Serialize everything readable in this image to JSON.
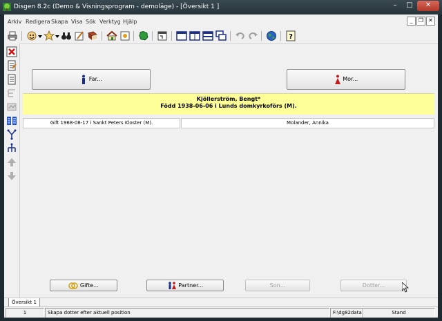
{
  "window": {
    "title": "Disgen 8.2c (Demo & Visningsprogram - demoläge) - [Översikt 1 ]",
    "controls": {
      "minimize": "–",
      "maximize": "□",
      "close": "✕"
    }
  },
  "menu": [
    "Arkiv",
    "Redigera",
    "Skapa",
    "Visa",
    "Sök",
    "Verktyg",
    "Hjälp"
  ],
  "mdi_controls": {
    "minimize": "_",
    "restore": "❐",
    "close": "✕"
  },
  "toolbar_icons": [
    "print-icon",
    "person-icon",
    "dropdown-icon",
    "person-search-icon",
    "dropdown-icon",
    "binoculars-icon",
    "notes-icon",
    "book-icon",
    "home-icon",
    "map-icon",
    "calendar-icon",
    "single-pane-icon",
    "split-pane-icon",
    "dual-pane-icon",
    "cascade-windows-icon",
    "undo-icon",
    "redo-icon",
    "globe-icon",
    "help-icon"
  ],
  "left_toolbar_icons": [
    "delete-icon",
    "edit-icon",
    "document-icon",
    "tree-icon",
    "chart-icon",
    "family-icon",
    "descendants-icon",
    "ancestors-icon",
    "arrow-up-icon",
    "arrow-down-icon"
  ],
  "parents": {
    "father_label": "Far...",
    "mother_label": "Mor..."
  },
  "person": {
    "name": "Kjöllerström, Bengt*",
    "birth": "Född 1938-06-06 i Lunds domkyrkoförs (M)."
  },
  "relations": {
    "marriage": "Gift 1968-08-17 i Sankt Peters Kloster (M).",
    "spouse": "Molander, Annika"
  },
  "actions": {
    "marriages": "Gifte...",
    "partner": "Partner...",
    "son": "Son...",
    "daughter": "Dotter..."
  },
  "tab": "Översikt 1",
  "status": {
    "number": "1",
    "message": "Skapa dotter efter aktuell position",
    "path": "F:\\dg82data",
    "mode": "Stand"
  },
  "colors": {
    "person_card": "#ffff99",
    "title_bar": "#2f3d44",
    "close_button": "#c4483a"
  }
}
